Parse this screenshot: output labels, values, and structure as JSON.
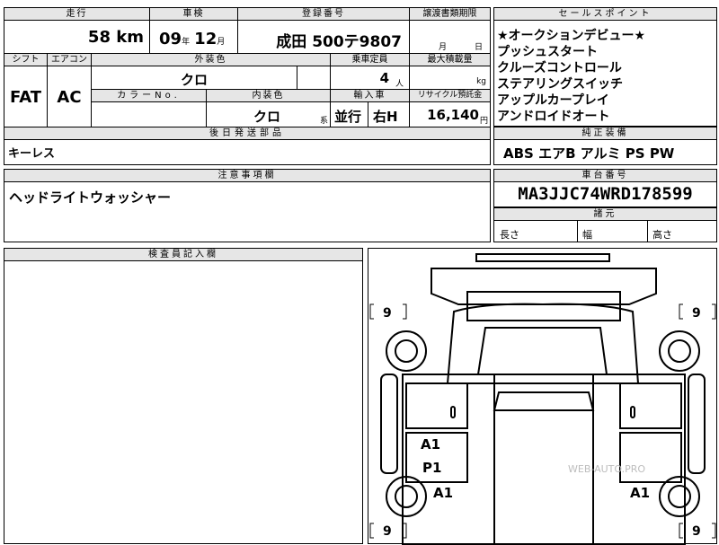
{
  "top": {
    "mileage_label": "走行",
    "mileage_value": "58",
    "mileage_unit": "km",
    "inspection_label": "車検",
    "inspection_year": "09",
    "inspection_year_unit": "年",
    "inspection_month": "12",
    "inspection_month_unit": "月",
    "registration_label": "登録番号",
    "registration_value": "成田 500テ9807",
    "transfer_label": "譲渡書類期限",
    "transfer_month_unit": "月",
    "transfer_day_unit": "日",
    "shift_label": "シフト",
    "shift_value": "FAT",
    "aircon_label": "エアコン",
    "aircon_value": "AC",
    "exterior_color_label": "外装色",
    "exterior_color_value": "クロ",
    "capacity_label": "乗車定員",
    "capacity_value": "4",
    "capacity_unit": "人",
    "max_load_label": "最大積載量",
    "max_load_unit": "kg",
    "color_no_label": "カラーNo.",
    "interior_color_label": "内装色",
    "interior_color_value": "クロ",
    "interior_color_suffix": "系",
    "import_label": "輸入車",
    "import_type": "並行",
    "steering": "右H",
    "recycle_label": "リサイクル預託金",
    "recycle_value": "16,140",
    "recycle_unit": "円",
    "delivery_label": "後日発送部品",
    "delivery_value": "キーレス"
  },
  "selling_points": {
    "label": "セールスポイント",
    "items": [
      "★オークションデビュー★",
      "プッシュスタート",
      "クルーズコントロール",
      "ステアリングスイッチ",
      "アップルカープレイ",
      "アンドロイドオート"
    ]
  },
  "equipment": {
    "label": "純正装備",
    "value": "ABS エアB アルミ PS PW"
  },
  "notes": {
    "label": "注意事項欄",
    "value": "ヘッドライトウォッシャー"
  },
  "chassis": {
    "label": "車台番号",
    "value": "MA3JJC74WRD178599"
  },
  "dimensions": {
    "label": "諸元",
    "length": "長さ",
    "width": "幅",
    "height": "高さ"
  },
  "inspector": {
    "label": "検査員記入欄"
  },
  "diagram": {
    "tire_fl": "9",
    "tire_fr": "9",
    "tire_rl": "9",
    "tire_rr": "9",
    "mark_a1_door": "A1",
    "mark_p1": "P1",
    "mark_a1_left": "A1",
    "mark_a1_right": "A1",
    "watermark": "WEB-AUTO.PRO"
  }
}
